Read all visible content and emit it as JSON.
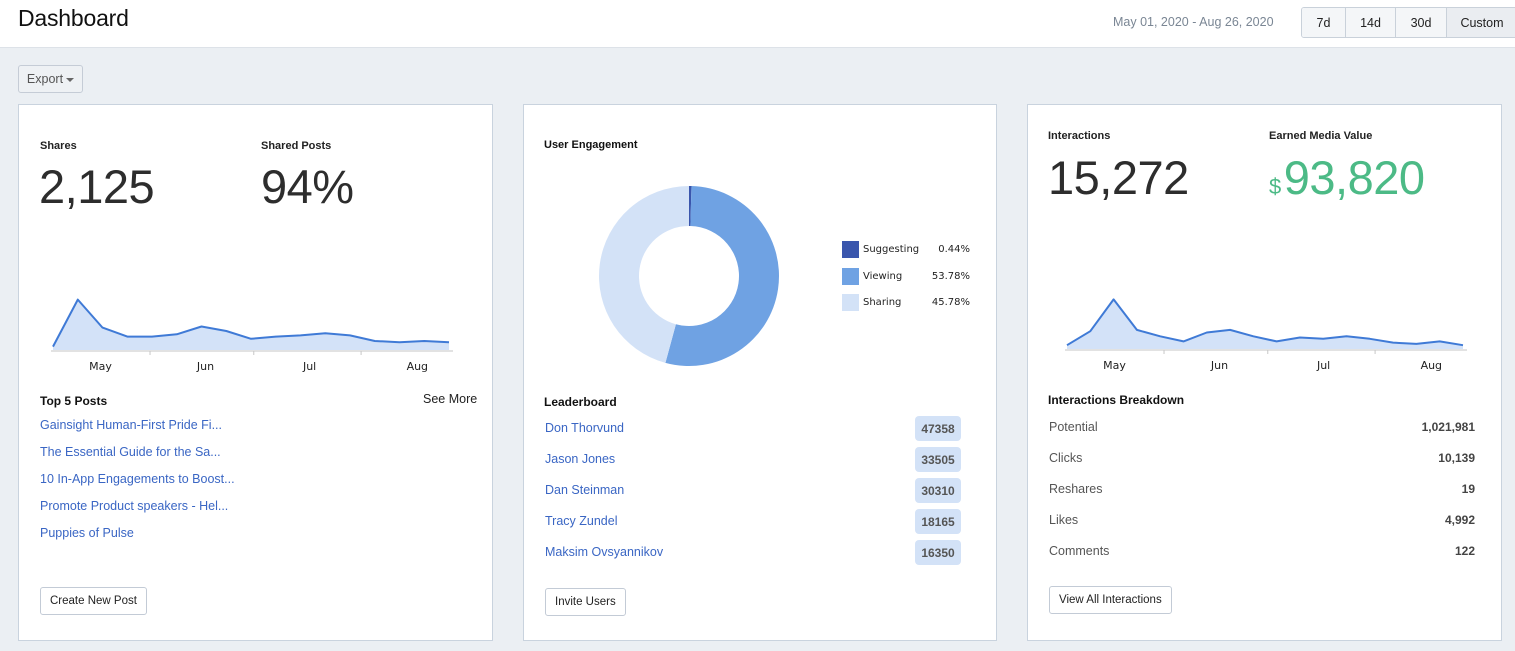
{
  "header": {
    "title": "Dashboard",
    "date_range": "May 01, 2020 - Aug 26, 2020",
    "range_buttons": [
      {
        "label": "7d"
      },
      {
        "label": "14d"
      },
      {
        "label": "30d"
      },
      {
        "label": "Custom",
        "selected": true
      }
    ]
  },
  "toolbar": {
    "export_label": "Export",
    "export_icon": "caret-down-icon"
  },
  "shares_card": {
    "shares_label": "Shares",
    "shares_value": "2,125",
    "shared_posts_label": "Shared Posts",
    "shared_posts_value": "94%",
    "top_posts_title": "Top 5 Posts",
    "see_more_label": "See More",
    "top_posts": [
      "Gainsight Human-First Pride Fi...",
      "The Essential Guide for the Sa...",
      "10 In-App Engagements to Boost...",
      "Promote Product speakers - Hel...",
      "Puppies of Pulse"
    ],
    "create_button_label": "Create New Post"
  },
  "engagement_card": {
    "title": "User Engagement",
    "leaderboard_title": "Leaderboard",
    "leaderboard": [
      {
        "name": "Don Thorvund",
        "score": "47358"
      },
      {
        "name": "Jason Jones",
        "score": "33505"
      },
      {
        "name": "Dan Steinman",
        "score": "30310"
      },
      {
        "name": "Tracy Zundel",
        "score": "18165"
      },
      {
        "name": "Maksim Ovsyannikov",
        "score": "16350"
      }
    ],
    "invite_button_label": "Invite Users"
  },
  "interactions_card": {
    "interactions_label": "Interactions",
    "interactions_value": "15,272",
    "emv_label": "Earned Media Value",
    "emv_currency": "$",
    "emv_value": "93,820",
    "emv_color": "#4cba86",
    "breakdown_title": "Interactions Breakdown",
    "breakdown": [
      {
        "label": "Potential",
        "value": "1,021,981"
      },
      {
        "label": "Clicks",
        "value": "10,139"
      },
      {
        "label": "Reshares",
        "value": "19"
      },
      {
        "label": "Likes",
        "value": "4,992"
      },
      {
        "label": "Comments",
        "value": "122"
      }
    ],
    "view_all_label": "View All Interactions"
  },
  "chart_data": [
    {
      "id": "shares-sparkline",
      "type": "area",
      "title": "",
      "xlabel": "",
      "ylabel": "",
      "x_ticks": [
        "May",
        "Jun",
        "Jul",
        "Aug"
      ],
      "grid": false,
      "series": [
        {
          "name": "Shares",
          "color": "#3f7ad6",
          "fill": "#d3e2f8",
          "values": [
            3,
            45,
            20,
            12,
            12,
            14,
            21,
            17,
            10,
            12,
            13,
            15,
            13,
            8,
            7,
            8,
            7
          ]
        }
      ],
      "ylim": [
        0,
        50
      ]
    },
    {
      "id": "user-engagement-donut",
      "type": "pie",
      "title": "User Engagement",
      "donut": true,
      "legend": "right",
      "slices": [
        {
          "label": "Suggesting",
          "value": 0.44,
          "display": "0.44%",
          "color": "#3a56ad"
        },
        {
          "label": "Viewing",
          "value": 53.78,
          "display": "53.78%",
          "color": "#6fa2e3"
        },
        {
          "label": "Sharing",
          "value": 45.78,
          "display": "45.78%",
          "color": "#d3e2f7"
        }
      ]
    },
    {
      "id": "interactions-sparkline",
      "type": "area",
      "title": "",
      "xlabel": "",
      "ylabel": "",
      "x_ticks": [
        "May",
        "Jun",
        "Jul",
        "Aug"
      ],
      "grid": false,
      "series": [
        {
          "name": "Interactions",
          "color": "#3f7ad6",
          "fill": "#d3e2f8",
          "values": [
            3,
            14,
            39,
            15,
            10,
            6,
            13,
            15,
            10,
            6,
            9,
            8,
            10,
            8,
            5,
            4,
            6,
            3
          ]
        }
      ],
      "ylim": [
        0,
        44
      ]
    }
  ]
}
